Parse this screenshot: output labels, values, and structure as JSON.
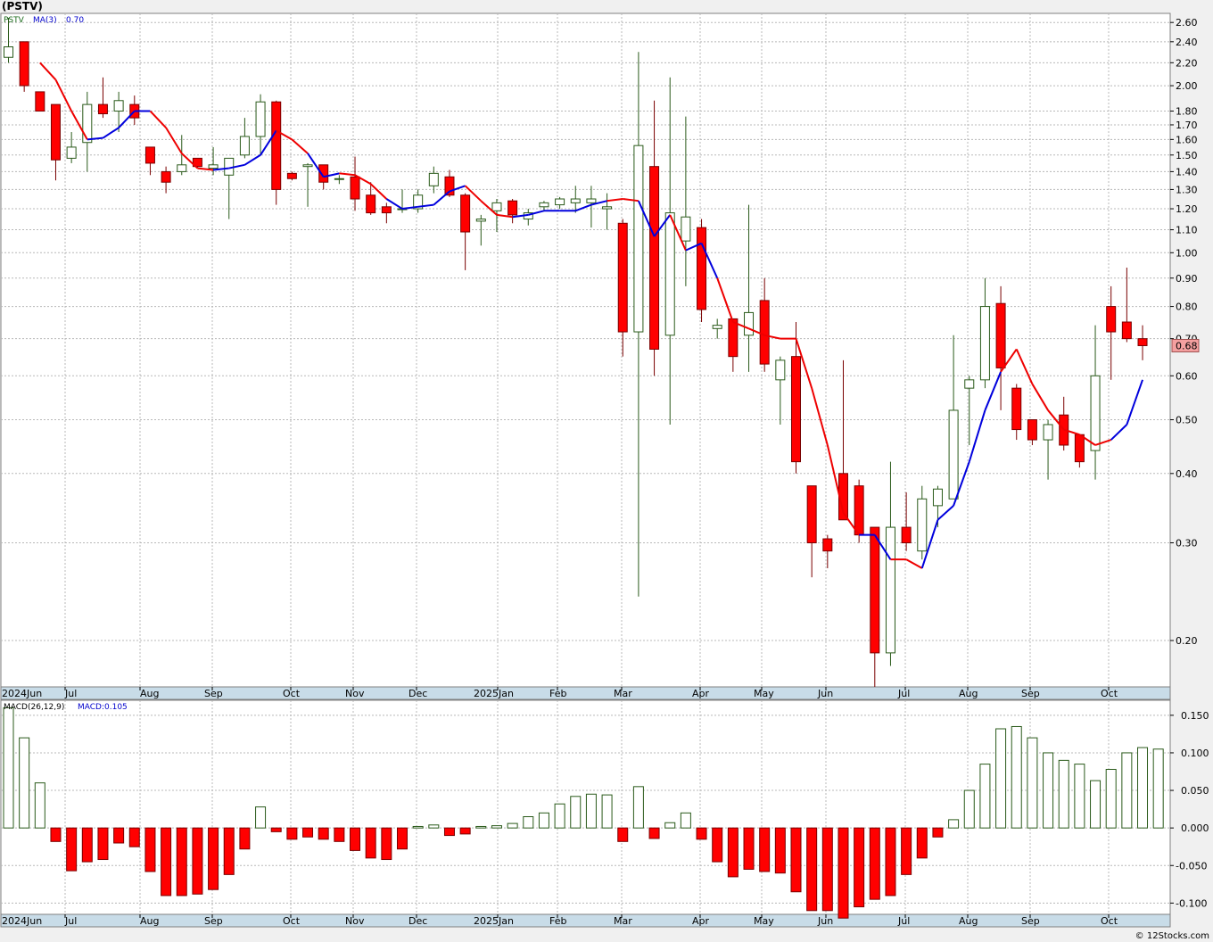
{
  "header": {
    "symbol_title": "(PSTV)"
  },
  "credit": "© 12Stocks.com",
  "colors": {
    "up": "#2a5a1a",
    "down_fill": "#ff0000",
    "down_border": "#7a0000",
    "ma_above": "#0000dd",
    "ma_below": "#ee0000",
    "grid": "#b8b8b8",
    "axis_band": "#c8dce8",
    "price_tag": "#f4a0a0"
  },
  "chart_data": [
    {
      "type": "candlestick",
      "scale": "log",
      "legend": {
        "symbol": "PSTV",
        "ma_label": "MA(3)",
        "ma_value": "0.70"
      },
      "ylim": [
        0.165,
        2.7
      ],
      "y_ticks": [
        "2.60",
        "2.40",
        "2.20",
        "2.00",
        "1.80",
        "1.70",
        "1.60",
        "1.50",
        "1.40",
        "1.30",
        "1.20",
        "1.10",
        "1.00",
        "0.90",
        "0.80",
        "0.70",
        "0.60",
        "0.50",
        "0.40",
        "0.30",
        "0.20"
      ],
      "last_price": "0.68",
      "x_labels": [
        "2024Jun",
        "Jul",
        "Aug",
        "Sep",
        "Oct",
        "Nov",
        "Dec",
        "2025Jan",
        "Feb",
        "Mar",
        "Apr",
        "May",
        "Jun",
        "Jul",
        "Aug",
        "Sep",
        "Oct"
      ],
      "grid": true,
      "candles": [
        {
          "o": 2.25,
          "h": 2.65,
          "l": 2.2,
          "c": 2.35
        },
        {
          "o": 2.4,
          "h": 2.4,
          "l": 1.95,
          "c": 2.0
        },
        {
          "o": 1.95,
          "h": 1.95,
          "l": 1.8,
          "c": 1.8
        },
        {
          "o": 1.85,
          "h": 1.85,
          "l": 1.35,
          "c": 1.47
        },
        {
          "o": 1.48,
          "h": 1.65,
          "l": 1.45,
          "c": 1.55
        },
        {
          "o": 1.58,
          "h": 1.95,
          "l": 1.4,
          "c": 1.85
        },
        {
          "o": 1.85,
          "h": 2.07,
          "l": 1.75,
          "c": 1.78
        },
        {
          "o": 1.8,
          "h": 1.95,
          "l": 1.65,
          "c": 1.88
        },
        {
          "o": 1.85,
          "h": 1.92,
          "l": 1.7,
          "c": 1.75
        },
        {
          "o": 1.55,
          "h": 1.55,
          "l": 1.38,
          "c": 1.45
        },
        {
          "o": 1.4,
          "h": 1.43,
          "l": 1.28,
          "c": 1.34
        },
        {
          "o": 1.4,
          "h": 1.63,
          "l": 1.38,
          "c": 1.44
        },
        {
          "o": 1.48,
          "h": 1.48,
          "l": 1.42,
          "c": 1.43
        },
        {
          "o": 1.42,
          "h": 1.55,
          "l": 1.38,
          "c": 1.44
        },
        {
          "o": 1.38,
          "h": 1.48,
          "l": 1.15,
          "c": 1.48
        },
        {
          "o": 1.5,
          "h": 1.75,
          "l": 1.48,
          "c": 1.62
        },
        {
          "o": 1.62,
          "h": 1.93,
          "l": 1.5,
          "c": 1.87
        },
        {
          "o": 1.87,
          "h": 1.88,
          "l": 1.22,
          "c": 1.3
        },
        {
          "o": 1.39,
          "h": 1.4,
          "l": 1.35,
          "c": 1.36
        },
        {
          "o": 1.43,
          "h": 1.45,
          "l": 1.21,
          "c": 1.44
        },
        {
          "o": 1.44,
          "h": 1.44,
          "l": 1.3,
          "c": 1.34
        },
        {
          "o": 1.36,
          "h": 1.38,
          "l": 1.33,
          "c": 1.36
        },
        {
          "o": 1.37,
          "h": 1.49,
          "l": 1.19,
          "c": 1.25
        },
        {
          "o": 1.27,
          "h": 1.34,
          "l": 1.17,
          "c": 1.18
        },
        {
          "o": 1.21,
          "h": 1.23,
          "l": 1.13,
          "c": 1.18
        },
        {
          "o": 1.2,
          "h": 1.3,
          "l": 1.18,
          "c": 1.2
        },
        {
          "o": 1.2,
          "h": 1.3,
          "l": 1.18,
          "c": 1.27
        },
        {
          "o": 1.32,
          "h": 1.43,
          "l": 1.28,
          "c": 1.39
        },
        {
          "o": 1.37,
          "h": 1.41,
          "l": 1.26,
          "c": 1.27
        },
        {
          "o": 1.27,
          "h": 1.28,
          "l": 0.93,
          "c": 1.09
        },
        {
          "o": 1.14,
          "h": 1.17,
          "l": 1.03,
          "c": 1.15
        },
        {
          "o": 1.19,
          "h": 1.25,
          "l": 1.09,
          "c": 1.23
        },
        {
          "o": 1.24,
          "h": 1.25,
          "l": 1.13,
          "c": 1.17
        },
        {
          "o": 1.15,
          "h": 1.2,
          "l": 1.12,
          "c": 1.18
        },
        {
          "o": 1.21,
          "h": 1.24,
          "l": 1.19,
          "c": 1.23
        },
        {
          "o": 1.22,
          "h": 1.26,
          "l": 1.2,
          "c": 1.25
        },
        {
          "o": 1.23,
          "h": 1.32,
          "l": 1.18,
          "c": 1.25
        },
        {
          "o": 1.23,
          "h": 1.32,
          "l": 1.11,
          "c": 1.25
        },
        {
          "o": 1.2,
          "h": 1.28,
          "l": 1.1,
          "c": 1.21
        },
        {
          "o": 1.13,
          "h": 1.15,
          "l": 0.65,
          "c": 0.72
        },
        {
          "o": 0.72,
          "h": 2.3,
          "l": 0.24,
          "c": 1.56
        },
        {
          "o": 1.43,
          "h": 1.88,
          "l": 0.6,
          "c": 0.67
        },
        {
          "o": 0.71,
          "h": 2.07,
          "l": 0.49,
          "c": 1.18
        },
        {
          "o": 1.05,
          "h": 1.76,
          "l": 0.87,
          "c": 1.16
        },
        {
          "o": 1.11,
          "h": 1.15,
          "l": 0.75,
          "c": 0.79
        },
        {
          "o": 0.73,
          "h": 0.76,
          "l": 0.7,
          "c": 0.74
        },
        {
          "o": 0.76,
          "h": 0.76,
          "l": 0.61,
          "c": 0.65
        },
        {
          "o": 0.71,
          "h": 1.22,
          "l": 0.61,
          "c": 0.78
        },
        {
          "o": 0.82,
          "h": 0.9,
          "l": 0.61,
          "c": 0.63
        },
        {
          "o": 0.59,
          "h": 0.65,
          "l": 0.49,
          "c": 0.64
        },
        {
          "o": 0.65,
          "h": 0.75,
          "l": 0.4,
          "c": 0.42
        },
        {
          "o": 0.38,
          "h": 0.38,
          "l": 0.26,
          "c": 0.3
        },
        {
          "o": 0.305,
          "h": 0.31,
          "l": 0.27,
          "c": 0.29
        },
        {
          "o": 0.4,
          "h": 0.64,
          "l": 0.33,
          "c": 0.33
        },
        {
          "o": 0.38,
          "h": 0.39,
          "l": 0.3,
          "c": 0.31
        },
        {
          "o": 0.32,
          "h": 0.32,
          "l": 0.165,
          "c": 0.19
        },
        {
          "o": 0.19,
          "h": 0.42,
          "l": 0.18,
          "c": 0.32
        },
        {
          "o": 0.32,
          "h": 0.37,
          "l": 0.29,
          "c": 0.3
        },
        {
          "o": 0.29,
          "h": 0.38,
          "l": 0.28,
          "c": 0.36
        },
        {
          "o": 0.35,
          "h": 0.38,
          "l": 0.32,
          "c": 0.375
        },
        {
          "o": 0.36,
          "h": 0.71,
          "l": 0.36,
          "c": 0.52
        },
        {
          "o": 0.57,
          "h": 0.6,
          "l": 0.45,
          "c": 0.59
        },
        {
          "o": 0.59,
          "h": 0.9,
          "l": 0.57,
          "c": 0.8
        },
        {
          "o": 0.81,
          "h": 0.87,
          "l": 0.52,
          "c": 0.62
        },
        {
          "o": 0.57,
          "h": 0.58,
          "l": 0.46,
          "c": 0.48
        },
        {
          "o": 0.5,
          "h": 0.5,
          "l": 0.45,
          "c": 0.46
        },
        {
          "o": 0.46,
          "h": 0.5,
          "l": 0.39,
          "c": 0.49
        },
        {
          "o": 0.51,
          "h": 0.55,
          "l": 0.44,
          "c": 0.45
        },
        {
          "o": 0.47,
          "h": 0.47,
          "l": 0.41,
          "c": 0.42
        },
        {
          "o": 0.44,
          "h": 0.74,
          "l": 0.39,
          "c": 0.6
        },
        {
          "o": 0.8,
          "h": 0.87,
          "l": 0.59,
          "c": 0.72
        },
        {
          "o": 0.75,
          "h": 0.94,
          "l": 0.69,
          "c": 0.7
        },
        {
          "o": 0.7,
          "h": 0.74,
          "l": 0.64,
          "c": 0.68
        }
      ],
      "ma3": [
        null,
        null,
        2.2,
        2.05,
        1.8,
        1.6,
        1.61,
        1.68,
        1.8,
        1.8,
        1.68,
        1.51,
        1.42,
        1.41,
        1.42,
        1.44,
        1.5,
        1.66,
        1.6,
        1.51,
        1.37,
        1.39,
        1.38,
        1.33,
        1.25,
        1.2,
        1.21,
        1.22,
        1.29,
        1.32,
        1.24,
        1.17,
        1.16,
        1.17,
        1.19,
        1.19,
        1.19,
        1.22,
        1.24,
        1.25,
        1.24,
        1.07,
        1.17,
        1.01,
        1.04,
        0.9,
        0.75,
        0.73,
        0.71,
        0.7,
        0.7,
        0.57,
        0.45,
        0.34,
        0.31,
        0.31,
        0.28,
        0.28,
        0.27,
        0.33,
        0.35,
        0.42,
        0.52,
        0.61,
        0.67,
        0.58,
        0.52,
        0.48,
        0.47,
        0.45,
        0.46,
        0.49,
        0.59,
        0.68,
        0.7
      ],
      "ma_color": [
        "r",
        "r",
        "r",
        "r",
        "r",
        "b",
        "b",
        "b",
        "b",
        "r",
        "r",
        "r",
        "r",
        "b",
        "b",
        "b",
        "b",
        "r",
        "r",
        "b",
        "b",
        "r",
        "r",
        "r",
        "b",
        "b",
        "b",
        "b",
        "b",
        "r",
        "r",
        "r",
        "b",
        "b",
        "b",
        "b",
        "b",
        "b",
        "r",
        "r",
        "b",
        "b",
        "r",
        "b",
        "b",
        "r",
        "r",
        "r",
        "r",
        "r",
        "r",
        "r",
        "r",
        "r",
        "b",
        "b",
        "r",
        "r",
        "b",
        "b",
        "b",
        "b",
        "b",
        "r",
        "r",
        "r",
        "r",
        "r",
        "r",
        "r",
        "b",
        "b",
        "b",
        "b"
      ]
    },
    {
      "type": "bar",
      "legend": {
        "label": "MACD(26,12,9)",
        "value_label": "MACD:0.105"
      },
      "ylim": [
        -0.115,
        0.17
      ],
      "y_ticks": [
        "0.150",
        "0.100",
        "0.050",
        "0.000",
        "-0.050",
        "-0.100"
      ],
      "values": [
        0.16,
        0.12,
        0.06,
        -0.018,
        -0.057,
        -0.045,
        -0.042,
        -0.02,
        -0.025,
        -0.058,
        -0.09,
        -0.09,
        -0.088,
        -0.082,
        -0.062,
        -0.028,
        0.028,
        -0.005,
        -0.015,
        -0.012,
        -0.015,
        -0.018,
        -0.03,
        -0.04,
        -0.042,
        -0.028,
        0.002,
        0.004,
        -0.01,
        -0.008,
        0.002,
        0.003,
        0.006,
        0.015,
        0.02,
        0.032,
        0.042,
        0.045,
        0.044,
        -0.018,
        0.055,
        -0.014,
        0.007,
        0.02,
        -0.015,
        -0.045,
        -0.065,
        -0.055,
        -0.058,
        -0.06,
        -0.085,
        -0.11,
        -0.11,
        -0.12,
        -0.105,
        -0.095,
        -0.09,
        -0.062,
        -0.04,
        -0.012,
        0.011,
        0.05,
        0.085,
        0.132,
        0.135,
        0.12,
        0.1,
        0.09,
        0.085,
        0.063,
        0.078,
        0.1,
        0.107,
        0.105
      ]
    }
  ]
}
